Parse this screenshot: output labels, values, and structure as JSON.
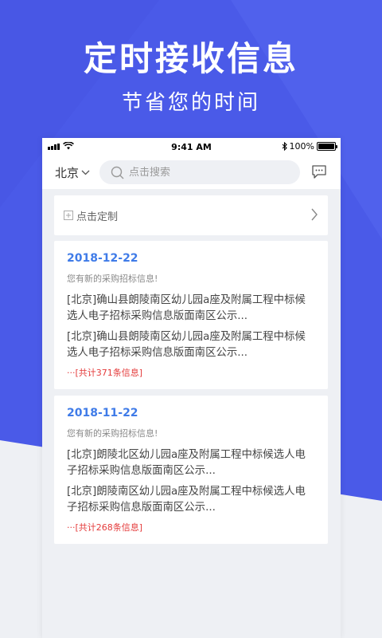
{
  "hero": {
    "title": "定时接收信息",
    "subtitle": "节省您的时间"
  },
  "colors": {
    "hero_blue": "#4a5ae8",
    "link_blue": "#3f7be8",
    "alert_red": "#e43a3a",
    "background": "#eef0f4"
  },
  "status_bar": {
    "time": "9:41 AM",
    "battery": "100%",
    "icons": [
      "signal-icon",
      "wifi-icon",
      "bluetooth-icon",
      "battery-icon"
    ]
  },
  "nav": {
    "city": "北京",
    "search_placeholder": "点击搜索",
    "icons": [
      "chevron-down-icon",
      "search-icon",
      "message-icon"
    ]
  },
  "customize": {
    "label": "点击定制",
    "icons": [
      "plus-square-icon",
      "chevron-right-icon"
    ]
  },
  "cards": [
    {
      "date": "2018-12-22",
      "notice": "您有新的采购招标信息!",
      "items": [
        "[北京]确山县朗陵南区幼儿园a座及附属工程中标候选人电子招标采购信息版面南区公示...",
        "[北京]确山县朗陵南区幼儿园a座及附属工程中标候选人电子招标采购信息版面南区公示..."
      ],
      "total": "···[共计371条信息]"
    },
    {
      "date": "2018-11-22",
      "notice": "您有新的采购招标信息!",
      "items": [
        "[北京]朗陵北区幼儿园a座及附属工程中标候选人电子招标采购信息版面南区公示...",
        "[北京]朗陵南区幼儿园a座及附属工程中标候选人电子招标采购信息版面南区公示..."
      ],
      "total": "···[共计268条信息]"
    }
  ]
}
